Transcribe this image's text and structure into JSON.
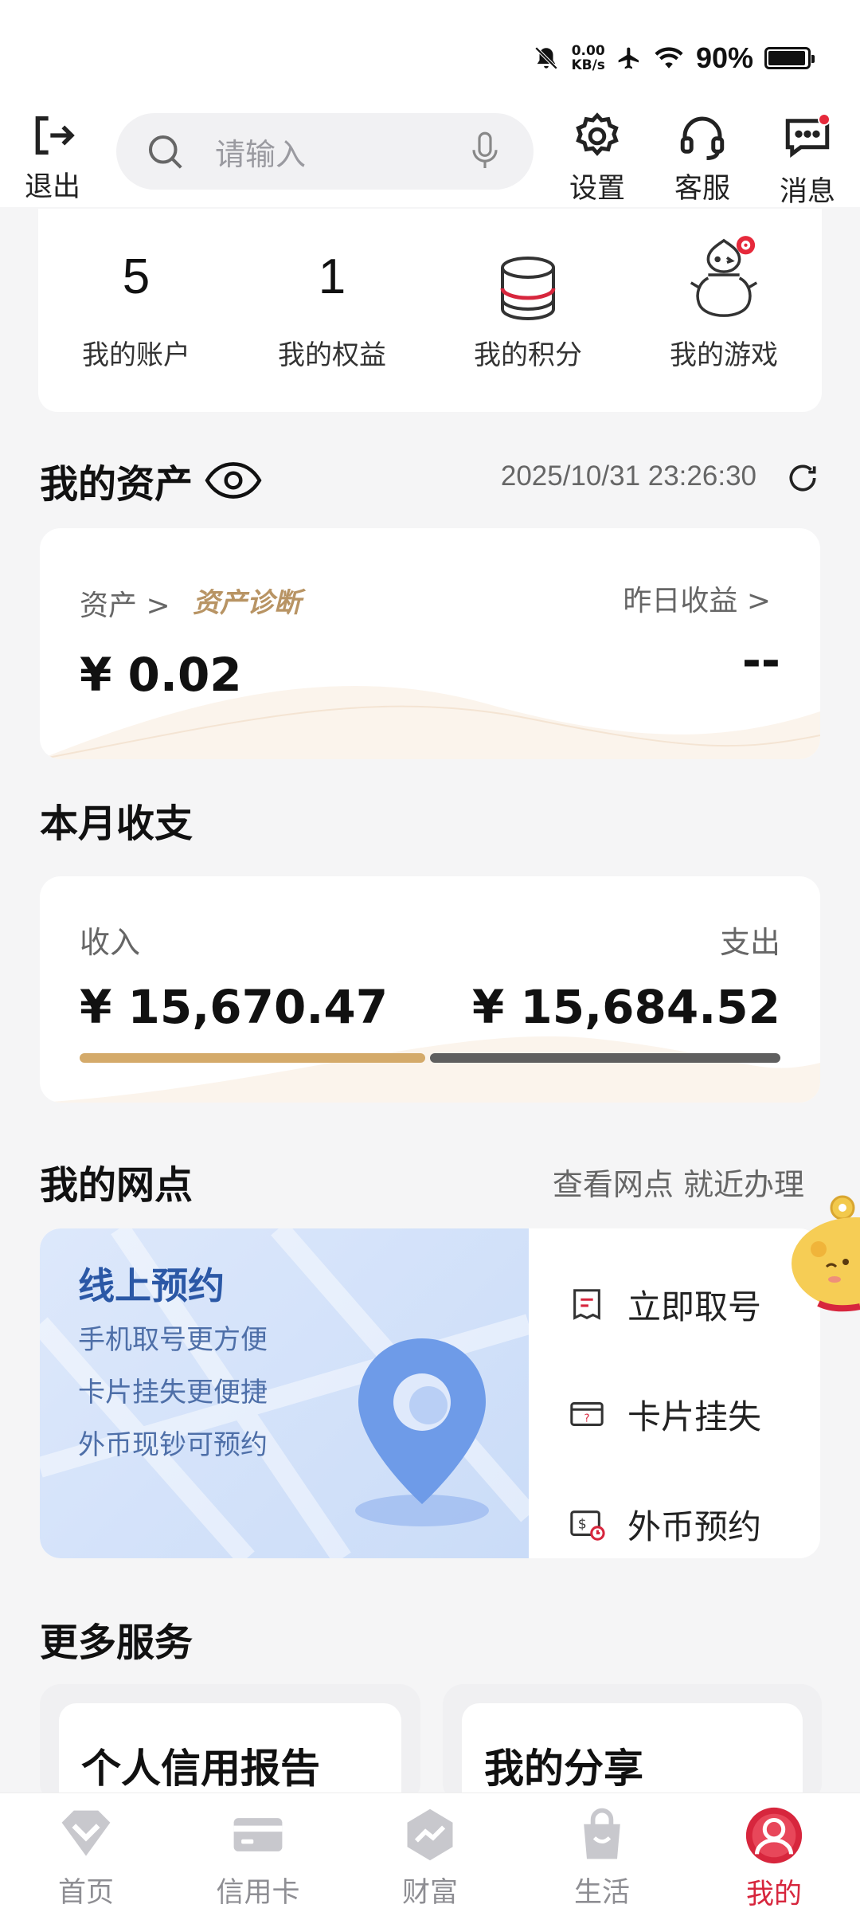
{
  "status_bar": {
    "net_speed_value": "0.00",
    "net_speed_unit": "KB/s",
    "battery": "90%"
  },
  "header": {
    "logout_label": "退出",
    "search_placeholder": "请输入",
    "settings_label": "设置",
    "service_label": "客服",
    "messages_label": "消息"
  },
  "stats": [
    {
      "value": "5",
      "label": "我的账户"
    },
    {
      "value": "1",
      "label": "我的权益"
    },
    {
      "icon": "database-icon",
      "label": "我的积分"
    },
    {
      "icon": "snowman-icon",
      "label": "我的游戏"
    }
  ],
  "assets": {
    "title": "我的资产",
    "timestamp": "2025/10/31 23:26:30",
    "asset_label": "资产 >",
    "diagnosis": "资产诊断",
    "asset_value": "¥ 0.02",
    "yesterday_label": "昨日收益 >",
    "yesterday_value": "--"
  },
  "monthly": {
    "title": "本月收支",
    "income_label": "收入",
    "income_value": "¥ 15,670.47",
    "expense_label": "支出",
    "expense_value": "¥ 15,684.52"
  },
  "branch": {
    "title": "我的网点",
    "link": "查看网点 就近办理",
    "promo_title": "线上预约",
    "promo_lines": [
      "手机取号更方便",
      "卡片挂失更便捷",
      "外币现钞可预约"
    ],
    "actions": [
      {
        "icon": "ticket-icon",
        "label": "立即取号"
      },
      {
        "icon": "card-question-icon",
        "label": "卡片挂失"
      },
      {
        "icon": "currency-icon",
        "label": "外币预约"
      }
    ]
  },
  "more": {
    "title": "更多服务",
    "items": [
      "个人信用报告",
      "我的分享"
    ]
  },
  "tabs": [
    {
      "label": "首页",
      "icon": "home-diamond-icon"
    },
    {
      "label": "信用卡",
      "icon": "credit-card-icon"
    },
    {
      "label": "财富",
      "icon": "wealth-icon"
    },
    {
      "label": "生活",
      "icon": "shopping-bag-icon"
    },
    {
      "label": "我的",
      "icon": "profile-icon"
    }
  ],
  "colors": {
    "accent_red": "#d7263d",
    "gold": "#d4aa6a",
    "expense_bar": "#5f5f5f",
    "promo_blue": "#2b58a6"
  }
}
